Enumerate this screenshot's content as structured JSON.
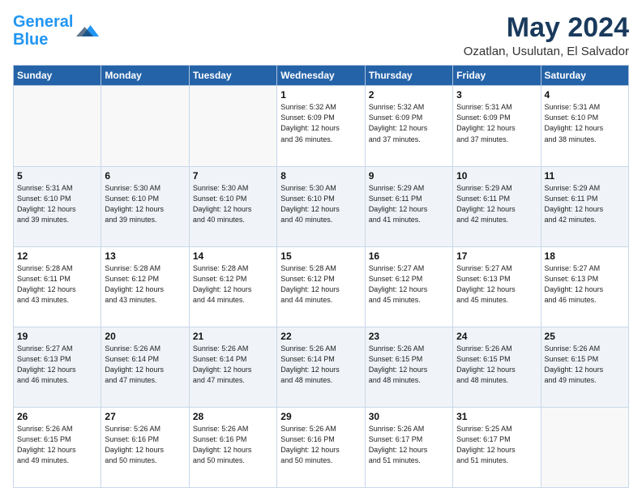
{
  "logo": {
    "line1": "General",
    "line2": "Blue"
  },
  "title": "May 2024",
  "location": "Ozatlan, Usulutan, El Salvador",
  "weekdays": [
    "Sunday",
    "Monday",
    "Tuesday",
    "Wednesday",
    "Thursday",
    "Friday",
    "Saturday"
  ],
  "weeks": [
    [
      {
        "day": "",
        "info": ""
      },
      {
        "day": "",
        "info": ""
      },
      {
        "day": "",
        "info": ""
      },
      {
        "day": "1",
        "info": "Sunrise: 5:32 AM\nSunset: 6:09 PM\nDaylight: 12 hours\nand 36 minutes."
      },
      {
        "day": "2",
        "info": "Sunrise: 5:32 AM\nSunset: 6:09 PM\nDaylight: 12 hours\nand 37 minutes."
      },
      {
        "day": "3",
        "info": "Sunrise: 5:31 AM\nSunset: 6:09 PM\nDaylight: 12 hours\nand 37 minutes."
      },
      {
        "day": "4",
        "info": "Sunrise: 5:31 AM\nSunset: 6:10 PM\nDaylight: 12 hours\nand 38 minutes."
      }
    ],
    [
      {
        "day": "5",
        "info": "Sunrise: 5:31 AM\nSunset: 6:10 PM\nDaylight: 12 hours\nand 39 minutes."
      },
      {
        "day": "6",
        "info": "Sunrise: 5:30 AM\nSunset: 6:10 PM\nDaylight: 12 hours\nand 39 minutes."
      },
      {
        "day": "7",
        "info": "Sunrise: 5:30 AM\nSunset: 6:10 PM\nDaylight: 12 hours\nand 40 minutes."
      },
      {
        "day": "8",
        "info": "Sunrise: 5:30 AM\nSunset: 6:10 PM\nDaylight: 12 hours\nand 40 minutes."
      },
      {
        "day": "9",
        "info": "Sunrise: 5:29 AM\nSunset: 6:11 PM\nDaylight: 12 hours\nand 41 minutes."
      },
      {
        "day": "10",
        "info": "Sunrise: 5:29 AM\nSunset: 6:11 PM\nDaylight: 12 hours\nand 42 minutes."
      },
      {
        "day": "11",
        "info": "Sunrise: 5:29 AM\nSunset: 6:11 PM\nDaylight: 12 hours\nand 42 minutes."
      }
    ],
    [
      {
        "day": "12",
        "info": "Sunrise: 5:28 AM\nSunset: 6:11 PM\nDaylight: 12 hours\nand 43 minutes."
      },
      {
        "day": "13",
        "info": "Sunrise: 5:28 AM\nSunset: 6:12 PM\nDaylight: 12 hours\nand 43 minutes."
      },
      {
        "day": "14",
        "info": "Sunrise: 5:28 AM\nSunset: 6:12 PM\nDaylight: 12 hours\nand 44 minutes."
      },
      {
        "day": "15",
        "info": "Sunrise: 5:28 AM\nSunset: 6:12 PM\nDaylight: 12 hours\nand 44 minutes."
      },
      {
        "day": "16",
        "info": "Sunrise: 5:27 AM\nSunset: 6:12 PM\nDaylight: 12 hours\nand 45 minutes."
      },
      {
        "day": "17",
        "info": "Sunrise: 5:27 AM\nSunset: 6:13 PM\nDaylight: 12 hours\nand 45 minutes."
      },
      {
        "day": "18",
        "info": "Sunrise: 5:27 AM\nSunset: 6:13 PM\nDaylight: 12 hours\nand 46 minutes."
      }
    ],
    [
      {
        "day": "19",
        "info": "Sunrise: 5:27 AM\nSunset: 6:13 PM\nDaylight: 12 hours\nand 46 minutes."
      },
      {
        "day": "20",
        "info": "Sunrise: 5:26 AM\nSunset: 6:14 PM\nDaylight: 12 hours\nand 47 minutes."
      },
      {
        "day": "21",
        "info": "Sunrise: 5:26 AM\nSunset: 6:14 PM\nDaylight: 12 hours\nand 47 minutes."
      },
      {
        "day": "22",
        "info": "Sunrise: 5:26 AM\nSunset: 6:14 PM\nDaylight: 12 hours\nand 48 minutes."
      },
      {
        "day": "23",
        "info": "Sunrise: 5:26 AM\nSunset: 6:15 PM\nDaylight: 12 hours\nand 48 minutes."
      },
      {
        "day": "24",
        "info": "Sunrise: 5:26 AM\nSunset: 6:15 PM\nDaylight: 12 hours\nand 48 minutes."
      },
      {
        "day": "25",
        "info": "Sunrise: 5:26 AM\nSunset: 6:15 PM\nDaylight: 12 hours\nand 49 minutes."
      }
    ],
    [
      {
        "day": "26",
        "info": "Sunrise: 5:26 AM\nSunset: 6:15 PM\nDaylight: 12 hours\nand 49 minutes."
      },
      {
        "day": "27",
        "info": "Sunrise: 5:26 AM\nSunset: 6:16 PM\nDaylight: 12 hours\nand 50 minutes."
      },
      {
        "day": "28",
        "info": "Sunrise: 5:26 AM\nSunset: 6:16 PM\nDaylight: 12 hours\nand 50 minutes."
      },
      {
        "day": "29",
        "info": "Sunrise: 5:26 AM\nSunset: 6:16 PM\nDaylight: 12 hours\nand 50 minutes."
      },
      {
        "day": "30",
        "info": "Sunrise: 5:26 AM\nSunset: 6:17 PM\nDaylight: 12 hours\nand 51 minutes."
      },
      {
        "day": "31",
        "info": "Sunrise: 5:25 AM\nSunset: 6:17 PM\nDaylight: 12 hours\nand 51 minutes."
      },
      {
        "day": "",
        "info": ""
      }
    ]
  ]
}
